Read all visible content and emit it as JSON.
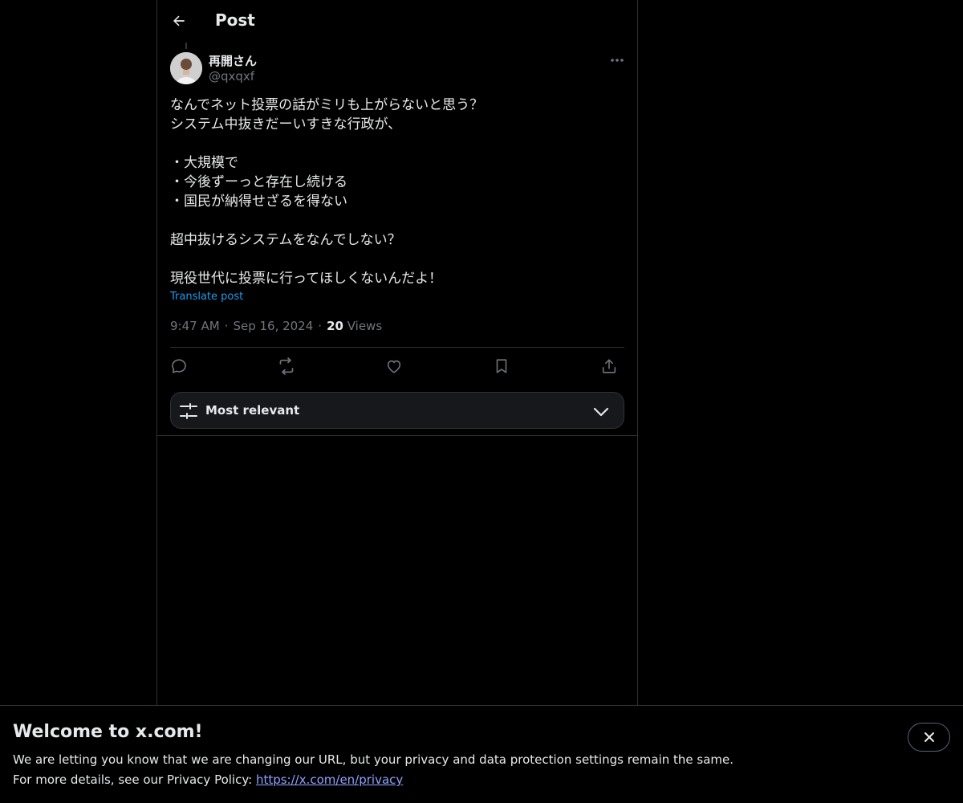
{
  "header": {
    "title": "Post",
    "back_icon": "arrow-left-icon"
  },
  "post": {
    "author": {
      "name": "再開さん",
      "handle": "@qxqxf"
    },
    "text_lines": [
      "なんでネット投票の話がミリも上がらないと思う？",
      "システム中抜きだーいすきな行政が、",
      "",
      "・大規模で",
      "・今後ずーっと存在し続ける",
      "・国民が納得せざるを得ない",
      "",
      "超中抜けるシステムをなんでしない？",
      "",
      "現役世代に投票に行ってほしくないんだよ！"
    ],
    "translate_label": "Translate post",
    "time": "9:47 AM",
    "date": "Sep 16, 2024",
    "separator": "·",
    "views_count": "20",
    "views_label": "Views",
    "actions": [
      "reply-icon",
      "repost-icon",
      "like-icon",
      "bookmark-icon",
      "share-icon"
    ]
  },
  "replies_sort": {
    "label": "Most relevant"
  },
  "banner": {
    "title": "Welcome to x.com!",
    "line1": "We are letting you know that we are changing our URL, but your privacy and data protection settings remain the same.",
    "line2_prefix": "For more details, see our Privacy Policy: ",
    "link_text": "https://x.com/en/privacy"
  },
  "colors": {
    "background": "#000000",
    "text": "#e7e9ea",
    "muted": "#71767b",
    "accent": "#1d9bf0",
    "border": "#2f3336"
  }
}
